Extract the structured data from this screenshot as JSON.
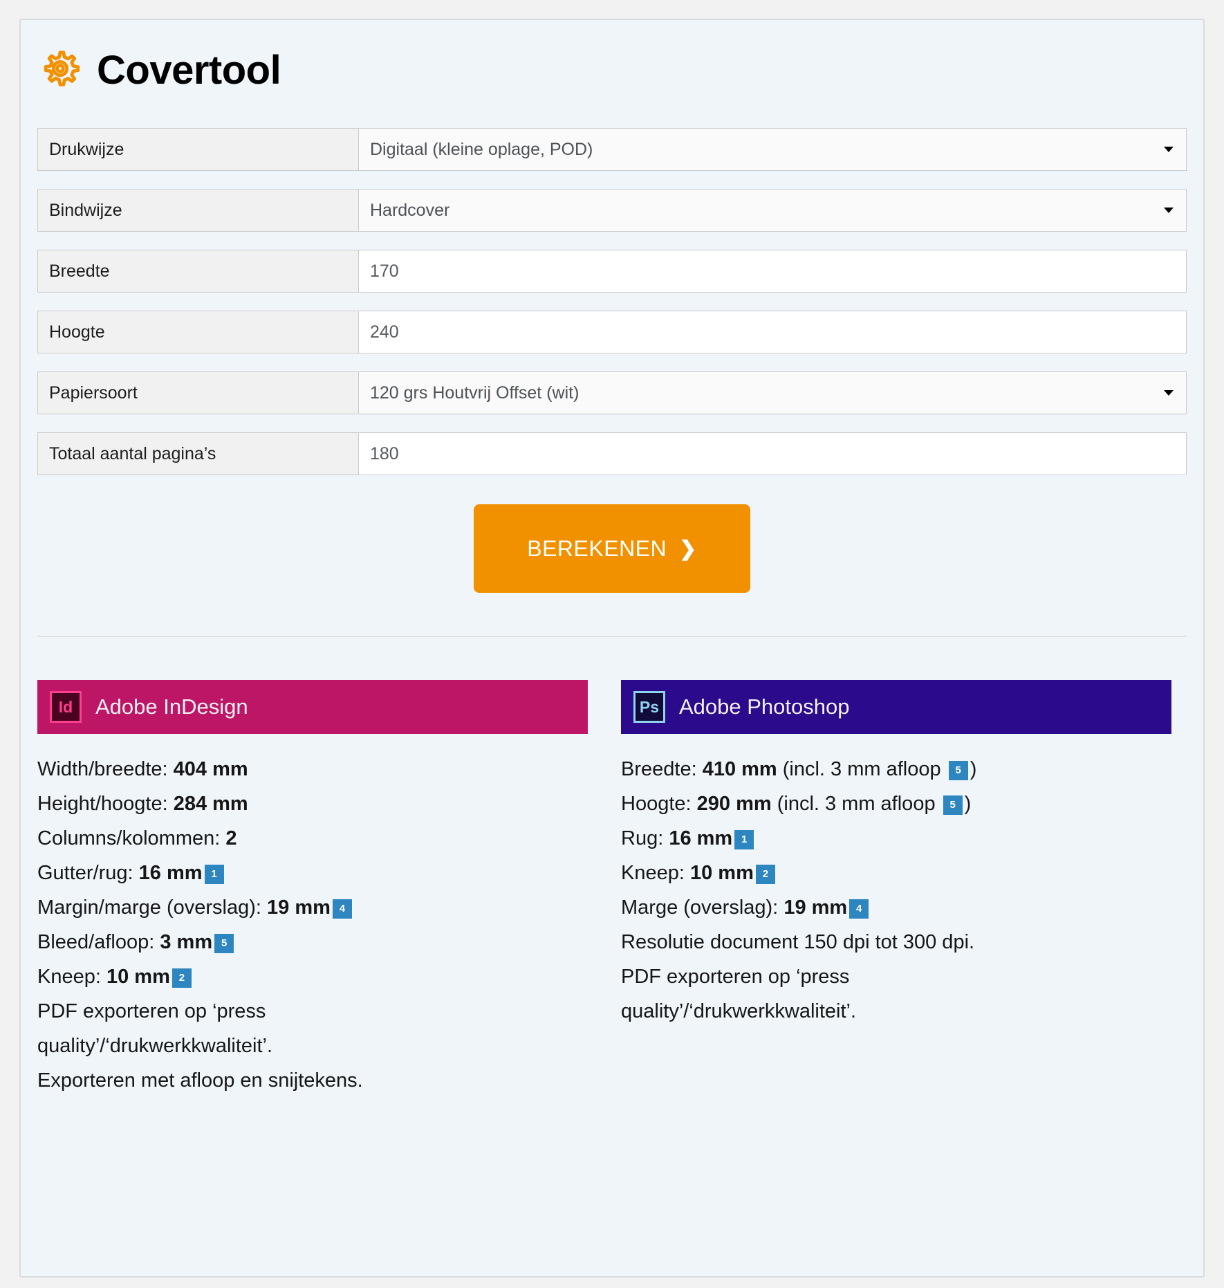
{
  "app": {
    "title": "Covertool",
    "gear_icon": "gear-icon",
    "accent_color": "#F29100",
    "card_background": "#F0F5FA",
    "page_background": "#F2F2F2"
  },
  "form": {
    "rows": [
      {
        "label": "Drukwijze",
        "value": "Digitaal (kleine oplage, POD)",
        "type": "select"
      },
      {
        "label": "Bindwijze",
        "value": "Hardcover",
        "type": "select"
      },
      {
        "label": "Breedte",
        "value": "170",
        "type": "text"
      },
      {
        "label": "Hoogte",
        "value": "240",
        "type": "text"
      },
      {
        "label": "Papiersoort",
        "value": "120 grs Houtvrij Offset (wit)",
        "type": "select"
      },
      {
        "label": "Totaal aantal pagina’s",
        "value": "180",
        "type": "text"
      }
    ],
    "submit": {
      "label": "BEREKENEN",
      "chevron": "chevron-right-icon",
      "color": "#F29100"
    }
  },
  "panels": [
    {
      "id": "indesign",
      "title": "Adobe InDesign",
      "badge": "Id",
      "header_color": "#BE1667",
      "specs": [
        {
          "label": "Width/breedte: ",
          "value": "404 mm",
          "suffix": "",
          "ref": null
        },
        {
          "label": "Height/hoogte: ",
          "value": "284 mm",
          "suffix": "",
          "ref": null
        },
        {
          "label": "Columns/kolommen: ",
          "value": "2",
          "suffix": "",
          "ref": null
        },
        {
          "label": "Gutter/rug: ",
          "value": "16 mm",
          "suffix": "",
          "ref": "1"
        },
        {
          "label": "Margin/marge (overslag): ",
          "value": "19 mm",
          "suffix": "",
          "ref": "4"
        },
        {
          "label": "Bleed/afloop: ",
          "value": "3 mm",
          "suffix": "",
          "ref": "5"
        },
        {
          "label": "Kneep: ",
          "value": "10 mm",
          "suffix": "",
          "ref": "2"
        },
        {
          "label": "PDF exporteren op ‘press",
          "value": "",
          "suffix": "",
          "ref": null
        },
        {
          "label": "quality’/‘drukwerkkwaliteit’.",
          "value": "",
          "suffix": "",
          "ref": null
        },
        {
          "label": "Exporteren met afloop en snijtekens.",
          "value": "",
          "suffix": "",
          "ref": null
        }
      ]
    },
    {
      "id": "photoshop",
      "title": "Adobe Photoshop",
      "badge": "Ps",
      "header_color": "#2B0A8C",
      "specs": [
        {
          "label": "Breedte: ",
          "value": "410 mm",
          "suffix": " (incl. 3 mm afloop ",
          "ref": "5",
          "tail": ")"
        },
        {
          "label": "Hoogte: ",
          "value": "290 mm",
          "suffix": " (incl. 3 mm afloop ",
          "ref": "5",
          "tail": ")"
        },
        {
          "label": "Rug: ",
          "value": "16 mm",
          "suffix": "",
          "ref": "1"
        },
        {
          "label": "Kneep: ",
          "value": "10 mm",
          "suffix": "",
          "ref": "2"
        },
        {
          "label": "Marge (overslag): ",
          "value": "19 mm",
          "suffix": "",
          "ref": "4"
        },
        {
          "label": "Resolutie document 150 dpi tot 300 dpi.",
          "value": "",
          "suffix": "",
          "ref": null
        },
        {
          "label": "PDF exporteren op ‘press",
          "value": "",
          "suffix": "",
          "ref": null
        },
        {
          "label": "quality’/‘drukwerkkwaliteit’.",
          "value": "",
          "suffix": "",
          "ref": null
        }
      ]
    }
  ],
  "ref_badge_color": "#2E86C1"
}
